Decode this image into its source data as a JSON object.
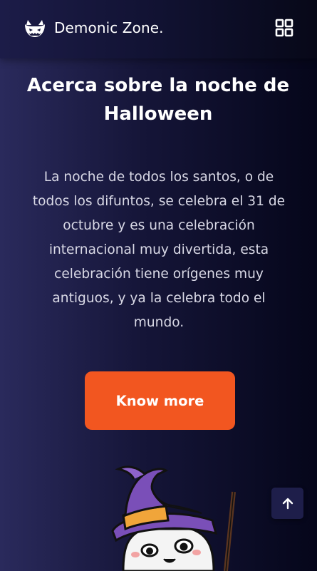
{
  "brand": {
    "name": "Demonic Zone.",
    "logo_icon": "pumpkin-face-icon"
  },
  "header": {
    "menu_icon": "grid-icon"
  },
  "hero": {
    "title": "Acerca sobre la noche de Halloween",
    "description": "La noche de todos los santos, o de todos los difuntos, se celebra el 31 de octubre y es una celebración internacional muy divertida, esta celebración tiene orígenes muy antiguos, y ya la celebra todo el mundo.",
    "cta_label": "Know more",
    "illustration": "ghost-witch-illustration"
  },
  "scroll_top": {
    "icon": "arrow-up-icon"
  },
  "colors": {
    "accent": "#f25620",
    "background_left": "#2a2a5c",
    "background_right": "#05061a",
    "hat": "#7a4fb8",
    "hat_band": "#f0a53a"
  }
}
